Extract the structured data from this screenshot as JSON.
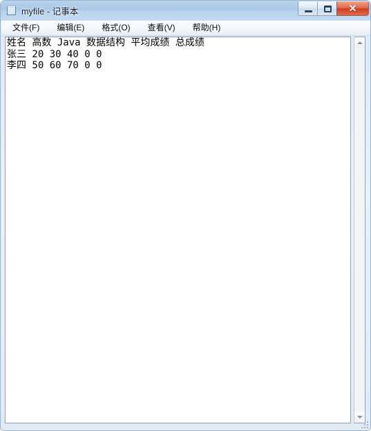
{
  "window": {
    "title": "myfile - 记事本",
    "icon": "notepad-icon"
  },
  "titlebar_buttons": {
    "minimize_label": "–",
    "restore_label": "□",
    "close_label": "✕"
  },
  "menu": {
    "items": [
      {
        "label": "文件(F)"
      },
      {
        "label": "编辑(E)"
      },
      {
        "label": "格式(O)"
      },
      {
        "label": "查看(V)"
      },
      {
        "label": "帮助(H)"
      }
    ]
  },
  "editor": {
    "lines": [
      "姓名 高数 Java 数据结构 平均成绩 总成绩",
      "张三 20 30 40 0 0",
      "李四 50 60 70 0 0"
    ],
    "content": "姓名 高数 Java 数据结构 平均成绩 总成绩\n张三 20 30 40 0 0\n李四 50 60 70 0 0",
    "word_wrap": "off"
  },
  "scrollbar": {
    "up_arrow": "scroll-up-arrow",
    "down_arrow": "scroll-down-arrow",
    "orientation": "vertical"
  },
  "colors": {
    "titlebar_top": "#b7d2ea",
    "titlebar_bottom": "#c6dcf1",
    "close_button": "#cc3f21",
    "frame_border": "#9cb4cd",
    "text": "#000000",
    "editor_background": "#ffffff"
  }
}
